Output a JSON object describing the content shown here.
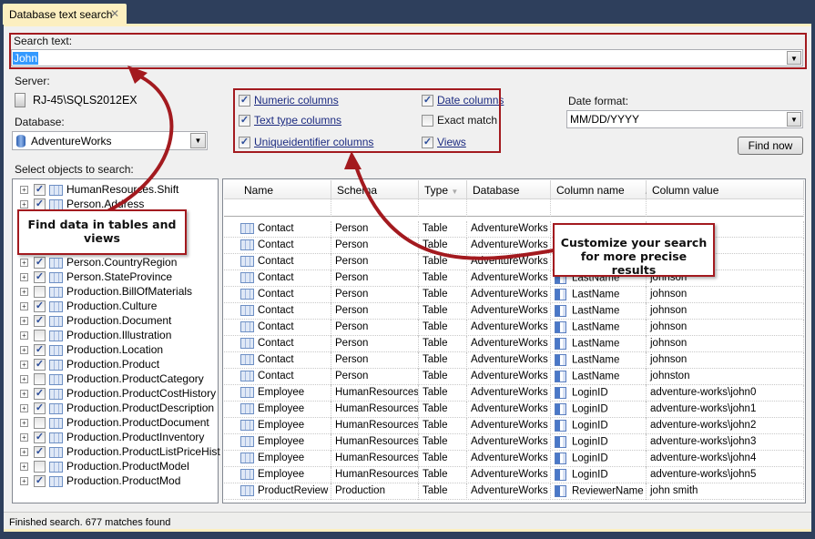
{
  "tab": {
    "title": "Database text search",
    "close_icon": "close-icon"
  },
  "search": {
    "label": "Search text:",
    "value": "John"
  },
  "server": {
    "label": "Server:",
    "value": "RJ-45\\SQLS2012EX"
  },
  "database": {
    "label": "Database:",
    "value": "AdventureWorks"
  },
  "options": [
    {
      "label": "Numeric columns",
      "checked": true
    },
    {
      "label": "Text type columns",
      "checked": true
    },
    {
      "label": "Uniqueidentifier columns",
      "checked": true
    },
    {
      "label": "Date columns",
      "checked": true
    },
    {
      "label": "Exact match",
      "checked": false
    },
    {
      "label": "Views",
      "checked": true
    }
  ],
  "date_format": {
    "label": "Date format:",
    "value": "MM/DD/YYYY"
  },
  "find_button": "Find now",
  "objects_label": "Select objects to search:",
  "tree": [
    {
      "label": "HumanResources.Shift",
      "checked": true
    },
    {
      "label": "Person.Address",
      "checked": true
    },
    {
      "label": "",
      "checked": true
    },
    {
      "label": "",
      "checked": true
    },
    {
      "label": "",
      "checked": true
    },
    {
      "label": "Person.CountryRegion",
      "checked": true
    },
    {
      "label": "Person.StateProvince",
      "checked": true
    },
    {
      "label": "Production.BillOfMaterials",
      "checked": false
    },
    {
      "label": "Production.Culture",
      "checked": true
    },
    {
      "label": "Production.Document",
      "checked": true
    },
    {
      "label": "Production.Illustration",
      "checked": false
    },
    {
      "label": "Production.Location",
      "checked": true
    },
    {
      "label": "Production.Product",
      "checked": true
    },
    {
      "label": "Production.ProductCategory",
      "checked": false
    },
    {
      "label": "Production.ProductCostHistory",
      "checked": true
    },
    {
      "label": "Production.ProductDescription",
      "checked": true
    },
    {
      "label": "Production.ProductDocument",
      "checked": false
    },
    {
      "label": "Production.ProductInventory",
      "checked": true
    },
    {
      "label": "Production.ProductListPriceHist",
      "checked": true
    },
    {
      "label": "Production.ProductModel",
      "checked": false
    },
    {
      "label": "Production.ProductMod",
      "checked": true
    }
  ],
  "grid": {
    "columns": [
      "Name",
      "Schema",
      "Type",
      "Database",
      "Column name",
      "Column value"
    ],
    "rows": [
      [
        "Contact",
        "Person",
        "Table",
        "AdventureWorks",
        "",
        ""
      ],
      [
        "Contact",
        "Person",
        "Table",
        "AdventureWorks",
        "",
        ""
      ],
      [
        "Contact",
        "Person",
        "Table",
        "AdventureWorks",
        "",
        ""
      ],
      [
        "Contact",
        "Person",
        "Table",
        "AdventureWorks",
        "LastName",
        "johnson"
      ],
      [
        "Contact",
        "Person",
        "Table",
        "AdventureWorks",
        "LastName",
        "johnson"
      ],
      [
        "Contact",
        "Person",
        "Table",
        "AdventureWorks",
        "LastName",
        "johnson"
      ],
      [
        "Contact",
        "Person",
        "Table",
        "AdventureWorks",
        "LastName",
        "johnson"
      ],
      [
        "Contact",
        "Person",
        "Table",
        "AdventureWorks",
        "LastName",
        "johnson"
      ],
      [
        "Contact",
        "Person",
        "Table",
        "AdventureWorks",
        "LastName",
        "johnson"
      ],
      [
        "Contact",
        "Person",
        "Table",
        "AdventureWorks",
        "LastName",
        "johnston"
      ],
      [
        "Employee",
        "HumanResources",
        "Table",
        "AdventureWorks",
        "LoginID",
        "adventure-works\\john0"
      ],
      [
        "Employee",
        "HumanResources",
        "Table",
        "AdventureWorks",
        "LoginID",
        "adventure-works\\john1"
      ],
      [
        "Employee",
        "HumanResources",
        "Table",
        "AdventureWorks",
        "LoginID",
        "adventure-works\\john2"
      ],
      [
        "Employee",
        "HumanResources",
        "Table",
        "AdventureWorks",
        "LoginID",
        "adventure-works\\john3"
      ],
      [
        "Employee",
        "HumanResources",
        "Table",
        "AdventureWorks",
        "LoginID",
        "adventure-works\\john4"
      ],
      [
        "Employee",
        "HumanResources",
        "Table",
        "AdventureWorks",
        "LoginID",
        "adventure-works\\john5"
      ],
      [
        "ProductReview",
        "Production",
        "Table",
        "AdventureWorks",
        "ReviewerName",
        "john smith"
      ]
    ]
  },
  "status": "Finished search. 677 matches found",
  "callouts": {
    "tables": "Find data in tables and views",
    "customize": "Customize your search for more precise results"
  },
  "colors": {
    "accent_red": "#a31a1f",
    "tab": "#fcefc0",
    "frame": "#2e3f5c"
  }
}
